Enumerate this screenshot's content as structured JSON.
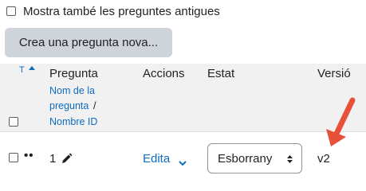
{
  "filter": {
    "show_old_label": "Mostra també les preguntes antigues"
  },
  "create_button": "Crea una pregunta nova...",
  "table": {
    "sort_indicator": "T",
    "headers": {
      "question": "Pregunta",
      "question_name_link": "Nom de la",
      "question_name_link2": "pregunta",
      "separator": "/",
      "name_id_link": "Nombre ID",
      "actions": "Accions",
      "status": "Estat",
      "version": "Versió"
    },
    "rows": [
      {
        "handle": "••",
        "number": "1",
        "action": "Edita",
        "status": "Esborrany",
        "version": "v2"
      }
    ]
  },
  "colors": {
    "link": "#0f6cbf",
    "annotation_arrow": "#e8503a",
    "header_bg": "#f1f1f1"
  }
}
